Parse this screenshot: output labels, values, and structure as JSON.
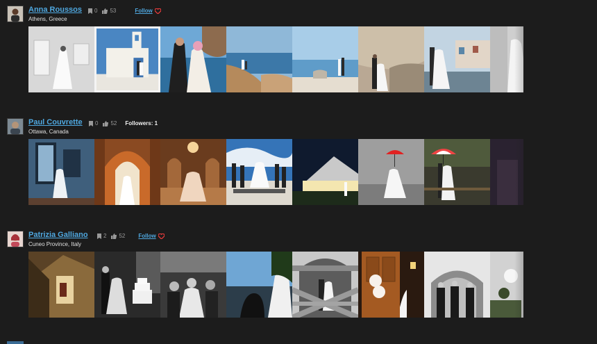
{
  "photographers": [
    {
      "name": "Anna Roussos",
      "location": "Athens, Greece",
      "bookmarks": "0",
      "likes": "53",
      "followers_text": "",
      "follow_label": "Follow",
      "photos": [
        {
          "label": "bride-in-white-room"
        },
        {
          "label": "couple-at-white-chapel"
        },
        {
          "label": "couple-seaside-embrace"
        },
        {
          "label": "couple-on-cliff-village"
        },
        {
          "label": "couple-on-rocks-sea"
        },
        {
          "label": "couple-by-rock-wall"
        },
        {
          "label": "couple-on-harbor"
        },
        {
          "label": "bride-faded-edge"
        }
      ]
    },
    {
      "name": "Paul Couvrette",
      "location": "Ottawa, Canada",
      "bookmarks": "0",
      "likes": "52",
      "followers_text": "Followers: 1",
      "follow_label": "",
      "photos": [
        {
          "label": "bride-by-window"
        },
        {
          "label": "bride-in-arched-doorway"
        },
        {
          "label": "bride-in-ballroom"
        },
        {
          "label": "wedding-party-chess-board"
        },
        {
          "label": "building-at-night"
        },
        {
          "label": "couple-red-umbrella"
        },
        {
          "label": "couple-red-umbrella-trees"
        },
        {
          "label": "dark-faded-edge"
        }
      ]
    },
    {
      "name": "Patrizia Galliano",
      "location": "Cuneo Province, Italy",
      "bookmarks": "2",
      "likes": "52",
      "followers_text": "",
      "follow_label": "Follow",
      "photos": [
        {
          "label": "staircase-interior"
        },
        {
          "label": "couple-cutting-cake"
        },
        {
          "label": "guests-celebration"
        },
        {
          "label": "couple-kiss-silhouette"
        },
        {
          "label": "couple-behind-wooden-fence"
        },
        {
          "label": "wooden-door-balloons"
        },
        {
          "label": "groomsmen-in-archway"
        },
        {
          "label": "flowers-faded-edge"
        }
      ]
    }
  ],
  "colors": {
    "background": "#1c1c1c",
    "link": "#4fa8e0",
    "heart": "#e33b3b",
    "stat": "#9a9a9a"
  },
  "icons": {
    "bookmark": "bookmark-icon",
    "like": "thumbs-up-icon",
    "follow": "heart-icon"
  }
}
